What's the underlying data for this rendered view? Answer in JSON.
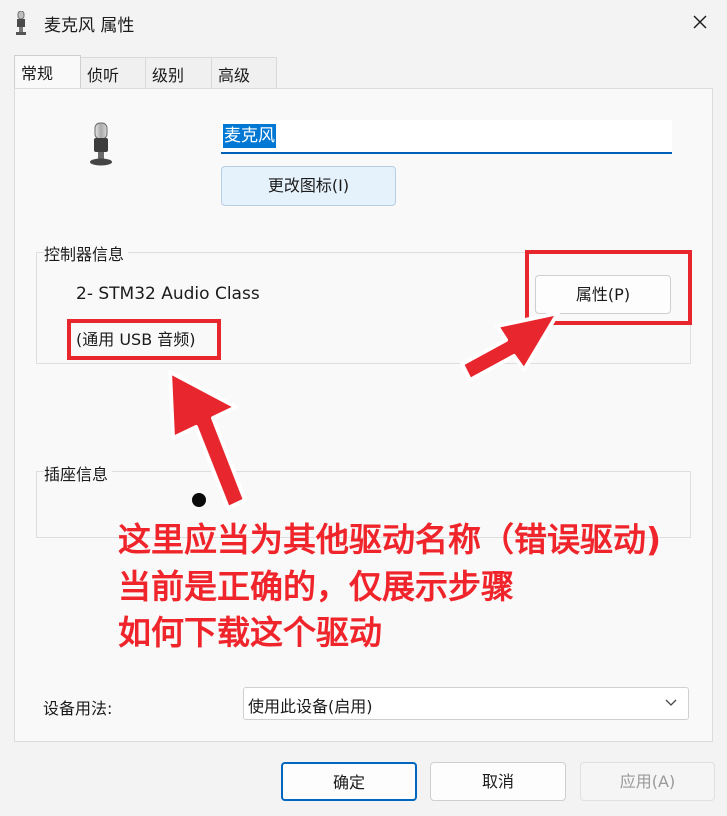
{
  "window": {
    "title": "麦克风 属性",
    "title_icon": "microphone-icon",
    "close_icon": "close-icon"
  },
  "tabs": [
    {
      "label": "常规",
      "active": true
    },
    {
      "label": "侦听",
      "active": false
    },
    {
      "label": "级别",
      "active": false
    },
    {
      "label": "高级",
      "active": false
    }
  ],
  "general": {
    "device_icon": "microphone-icon",
    "device_name": "麦克风",
    "change_icon_label": "更改图标(I)",
    "controller_group_label": "控制器信息",
    "controller_name": "2- STM32 Audio Class",
    "controller_driver": "(通用 USB 音频)",
    "controller_properties_label": "属性(P)",
    "jack_group_label": "插座信息",
    "usage_label": "设备用法:",
    "usage_value": "使用此设备(启用)"
  },
  "annotation": {
    "line1": "这里应当为其他驱动名称（错误驱动)",
    "line2": "当前是正确的，仅展示步骤",
    "line3": "如何下载这个驱动",
    "color": "#f0252b"
  },
  "footer": {
    "ok_label": "确定",
    "cancel_label": "取消",
    "apply_label": "应用(A)"
  }
}
